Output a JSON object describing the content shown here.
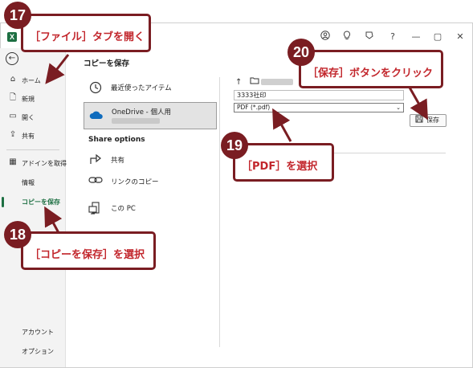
{
  "titlebar": {
    "app_icon": "X",
    "icons": [
      "avatar-icon",
      "lightbulb-icon",
      "diamond-icon",
      "help-icon",
      "minimize-icon",
      "restore-icon",
      "close-icon"
    ],
    "help": "?",
    "minimize": "—",
    "restore": "▢",
    "close": "✕"
  },
  "sidebar": {
    "back": "←",
    "items": [
      {
        "label": "ホーム",
        "icon": "home-icon"
      },
      {
        "label": "新規",
        "icon": "new-file-icon"
      },
      {
        "label": "開く",
        "icon": "folder-open-icon"
      },
      {
        "label": "共有",
        "icon": "share-icon"
      },
      {
        "label": "アドインを取得",
        "icon": "addin-icon"
      },
      {
        "label": "情報"
      },
      {
        "label": "コピーを保存"
      },
      {
        "label": "アカウント"
      },
      {
        "label": "オプション"
      }
    ]
  },
  "main": {
    "title": "コピーを保存",
    "locations": [
      {
        "label": "最近使ったアイテム",
        "icon": "clock-icon"
      },
      {
        "label": "OneDrive - 個人用",
        "icon": "onedrive-icon"
      },
      {
        "label": "共有",
        "icon": "share-icon"
      },
      {
        "label": "リンクのコピー",
        "icon": "link-icon"
      },
      {
        "label": "この PC",
        "icon": "pc-icon"
      }
    ],
    "share_options": "Share options"
  },
  "save_panel": {
    "up": "↑",
    "filename": "3333社印",
    "filetype": "PDF (*.pdf)",
    "save_label": "保存"
  },
  "callouts": {
    "c17": {
      "num": "17",
      "text": "［ファイル］タブを開く"
    },
    "c18": {
      "num": "18",
      "text": "［コピーを保存］を選択"
    },
    "c19": {
      "num": "19",
      "text": "［PDF］を選択"
    },
    "c20": {
      "num": "20",
      "text": "［保存］ボタンをクリック"
    }
  },
  "colors": {
    "accent": "#1d6f42",
    "callout_border": "#7a1d22",
    "callout_text": "#c2262c"
  }
}
